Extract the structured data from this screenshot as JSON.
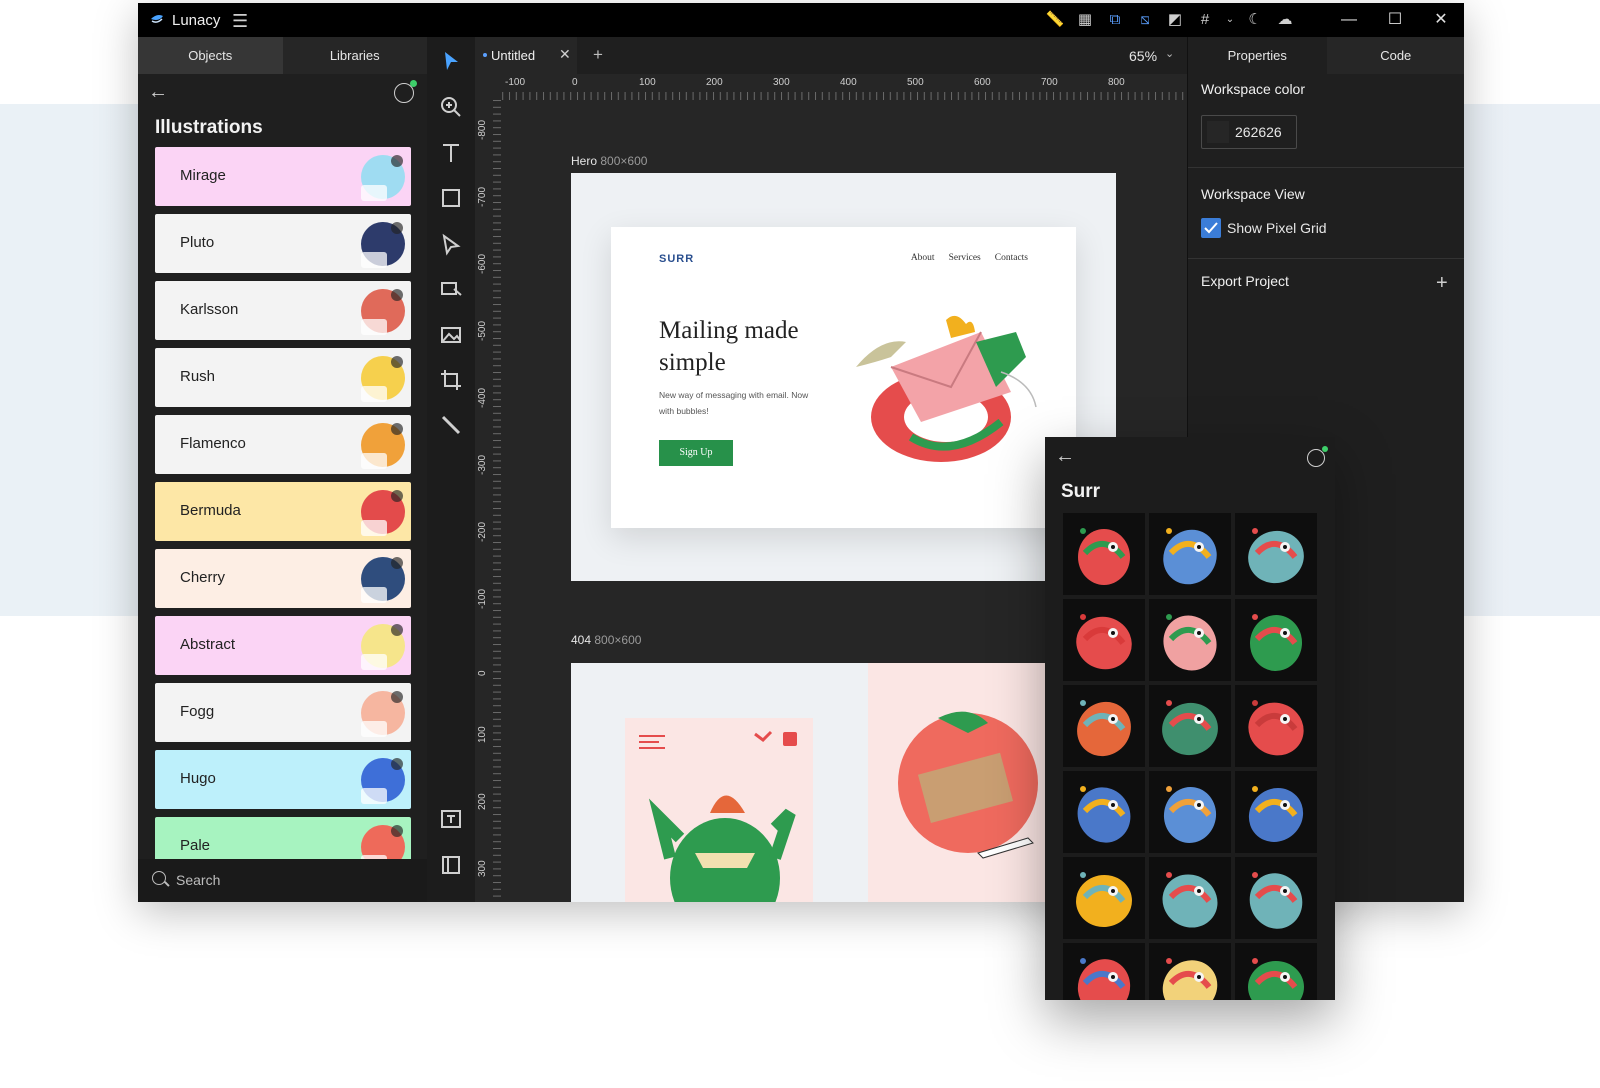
{
  "app": {
    "title": "Lunacy",
    "brand_color": "#4aa3ff"
  },
  "left_panel": {
    "tabs": [
      {
        "label": "Objects",
        "active": true
      },
      {
        "label": "Libraries",
        "active": false
      }
    ],
    "heading": "Illustrations",
    "libraries": [
      {
        "label": "Mirage",
        "bg": "#fbd4f5",
        "art": "#9fdcf2"
      },
      {
        "label": "Pluto",
        "bg": "#f3f3f3",
        "art": "#2d3b6b"
      },
      {
        "label": "Karlsson",
        "bg": "#f3f3f3",
        "art": "#e06a5a"
      },
      {
        "label": "Rush",
        "bg": "#f3f3f3",
        "art": "#f6d04d"
      },
      {
        "label": "Flamenco",
        "bg": "#f3f3f3",
        "art": "#f0a13a"
      },
      {
        "label": "Bermuda",
        "bg": "#fde7a6",
        "art": "#e34b4b"
      },
      {
        "label": "Cherry",
        "bg": "#fdeee4",
        "art": "#2f4d7d"
      },
      {
        "label": "Abstract",
        "bg": "#fbd4f5",
        "art": "#f6e58b"
      },
      {
        "label": "Fogg",
        "bg": "#f3f3f3",
        "art": "#f6b6a0"
      },
      {
        "label": "Hugo",
        "bg": "#bdf0fb",
        "art": "#3e6fd8"
      },
      {
        "label": "Pale",
        "bg": "#a7f3c0",
        "art": "#ee6a5a"
      }
    ],
    "search_placeholder": "Search"
  },
  "document": {
    "tab_name": "Untitled",
    "zoom": "65%",
    "ruler_top": [
      "-100",
      "0",
      "100",
      "200",
      "300",
      "400",
      "500",
      "600",
      "700",
      "800"
    ],
    "ruler_left": [
      "-800",
      "-700",
      "-600",
      "-500",
      "-400",
      "-300",
      "-200",
      "-100",
      "0",
      "100",
      "200",
      "300"
    ]
  },
  "canvas": {
    "hero": {
      "name": "Hero",
      "dims": "800×600",
      "logo": "SURR",
      "nav": [
        "About",
        "Services",
        "Contacts"
      ],
      "headline": "Mailing made simple",
      "subtext": "New way of messaging with email. Now with bubbles!",
      "cta": "Sign Up"
    },
    "artboard_404": {
      "name": "404",
      "dims": "800×600"
    }
  },
  "right_panel": {
    "tabs": [
      {
        "label": "Properties",
        "active": true
      },
      {
        "label": "Code",
        "active": false
      }
    ],
    "workspace_color_title": "Workspace color",
    "workspace_color_value": "262626",
    "workspace_color_swatch": "#262626",
    "workspace_view_title": "Workspace View",
    "show_pixel_grid_label": "Show Pixel Grid",
    "show_pixel_grid_checked": true,
    "export_title": "Export Project"
  },
  "float_panel": {
    "title": "Surr",
    "thumbnails": [
      {
        "name": "closed-tomato",
        "main": "#e54c4c",
        "accent": "#2e9b4f"
      },
      {
        "name": "blue-monster",
        "main": "#5b8fd6",
        "accent": "#f2b01e"
      },
      {
        "name": "teal-creature",
        "main": "#6fb3b8",
        "accent": "#e54c4c"
      },
      {
        "name": "red-swirl",
        "main": "#e54c4c",
        "accent": "#d93a3a"
      },
      {
        "name": "pink-envelope",
        "main": "#f0a1a1",
        "accent": "#2e9b4f"
      },
      {
        "name": "green-ball",
        "main": "#2e9b4f",
        "accent": "#e54c4c"
      },
      {
        "name": "orange-loop",
        "main": "#e5673a",
        "accent": "#6fb3b8"
      },
      {
        "name": "green-eye",
        "main": "#3f8f6e",
        "accent": "#e54c4c"
      },
      {
        "name": "red-knot",
        "main": "#e54c4c",
        "accent": "#c93b3b"
      },
      {
        "name": "blue-yellow-knot",
        "main": "#4a78c9",
        "accent": "#f2b01e"
      },
      {
        "name": "blue-tower",
        "main": "#5b8fd6",
        "accent": "#f0a13a"
      },
      {
        "name": "zero-bubble",
        "main": "#4a78c9",
        "accent": "#f2b01e"
      },
      {
        "name": "yellow-maze",
        "main": "#f2b01e",
        "accent": "#6fb3b8"
      },
      {
        "name": "stick-eye",
        "main": "#6fb3b8",
        "accent": "#e54c4c"
      },
      {
        "name": "teal-creature-2",
        "main": "#6fb3b8",
        "accent": "#e54c4c"
      },
      {
        "name": "red-hands",
        "main": "#e54c4c",
        "accent": "#4a78c9"
      },
      {
        "name": "yellow-face",
        "main": "#f2d27a",
        "accent": "#e54c4c"
      },
      {
        "name": "green-ball-2",
        "main": "#2e9b4f",
        "accent": "#e54c4c"
      }
    ]
  }
}
